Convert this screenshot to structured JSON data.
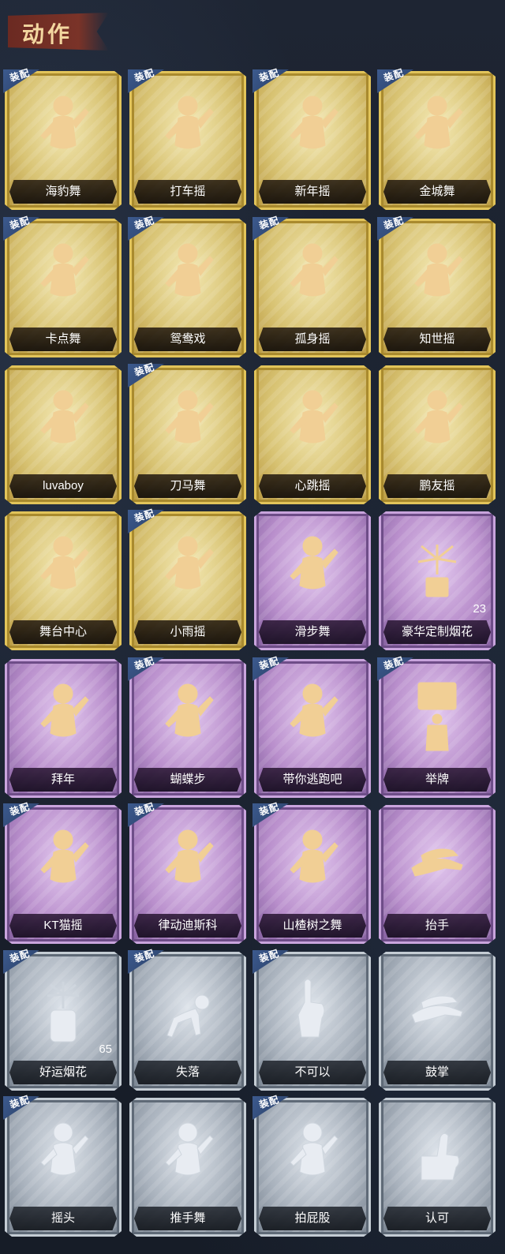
{
  "header": {
    "title": "动作"
  },
  "equip_label": "装配",
  "cards": [
    {
      "label": "海豹舞",
      "rarity": "gold",
      "equipped": true,
      "icon": "dance-figure-icon"
    },
    {
      "label": "打车摇",
      "rarity": "gold",
      "equipped": true,
      "icon": "dance-figure-icon"
    },
    {
      "label": "新年摇",
      "rarity": "gold",
      "equipped": true,
      "icon": "dance-figure-icon"
    },
    {
      "label": "金城舞",
      "rarity": "gold",
      "equipped": true,
      "icon": "dance-figure-icon"
    },
    {
      "label": "卡点舞",
      "rarity": "gold",
      "equipped": true,
      "icon": "dance-figure-icon"
    },
    {
      "label": "鸳鸯戏",
      "rarity": "gold",
      "equipped": true,
      "icon": "dance-figure-icon"
    },
    {
      "label": "孤身摇",
      "rarity": "gold",
      "equipped": true,
      "icon": "dance-figure-icon"
    },
    {
      "label": "知世摇",
      "rarity": "gold",
      "equipped": true,
      "icon": "dance-figure-icon"
    },
    {
      "label": "luvaboy",
      "rarity": "gold",
      "equipped": false,
      "icon": "dance-figure-icon"
    },
    {
      "label": "刀马舞",
      "rarity": "gold",
      "equipped": true,
      "icon": "dance-figure-icon"
    },
    {
      "label": "心跳摇",
      "rarity": "gold",
      "equipped": false,
      "icon": "dance-figure-icon"
    },
    {
      "label": "鹏友摇",
      "rarity": "gold",
      "equipped": false,
      "icon": "dance-figure-icon"
    },
    {
      "label": "舞台中心",
      "rarity": "gold",
      "equipped": false,
      "icon": "dance-figure-icon"
    },
    {
      "label": "小雨摇",
      "rarity": "gold",
      "equipped": true,
      "icon": "dance-figure-icon"
    },
    {
      "label": "滑步舞",
      "rarity": "purple",
      "equipped": false,
      "icon": "dance-figure-icon"
    },
    {
      "label": "豪华定制烟花",
      "rarity": "purple",
      "equipped": false,
      "icon": "fireworks-icon",
      "count": "23"
    },
    {
      "label": "拜年",
      "rarity": "purple",
      "equipped": false,
      "icon": "greeting-figure-icon"
    },
    {
      "label": "蝴蝶步",
      "rarity": "purple",
      "equipped": true,
      "icon": "dance-figure-icon"
    },
    {
      "label": "带你逃跑吧",
      "rarity": "purple",
      "equipped": true,
      "icon": "dance-figure-icon"
    },
    {
      "label": "举牌",
      "rarity": "purple",
      "equipped": true,
      "icon": "sign-holding-icon"
    },
    {
      "label": "KT猫摇",
      "rarity": "purple",
      "equipped": true,
      "icon": "dance-figure-icon"
    },
    {
      "label": "律动迪斯科",
      "rarity": "purple",
      "equipped": true,
      "icon": "dance-figure-icon"
    },
    {
      "label": "山楂树之舞",
      "rarity": "purple",
      "equipped": true,
      "icon": "dance-figure-icon"
    },
    {
      "label": "抬手",
      "rarity": "purple",
      "equipped": false,
      "icon": "raise-hand-icon"
    },
    {
      "label": "好运烟花",
      "rarity": "silver",
      "equipped": true,
      "icon": "firework-can-icon",
      "count": "65"
    },
    {
      "label": "失落",
      "rarity": "silver",
      "equipped": true,
      "icon": "crawling-figure-icon"
    },
    {
      "label": "不可以",
      "rarity": "silver",
      "equipped": true,
      "icon": "finger-wag-icon"
    },
    {
      "label": "鼓掌",
      "rarity": "silver",
      "equipped": false,
      "icon": "clapping-hands-icon"
    },
    {
      "label": "摇头",
      "rarity": "silver",
      "equipped": true,
      "icon": "shaking-head-icon"
    },
    {
      "label": "推手舞",
      "rarity": "silver",
      "equipped": false,
      "icon": "dance-figure-icon"
    },
    {
      "label": "拍屁股",
      "rarity": "silver",
      "equipped": true,
      "icon": "dance-figure-icon"
    },
    {
      "label": "认可",
      "rarity": "silver",
      "equipped": false,
      "icon": "thumbs-up-icon"
    }
  ]
}
